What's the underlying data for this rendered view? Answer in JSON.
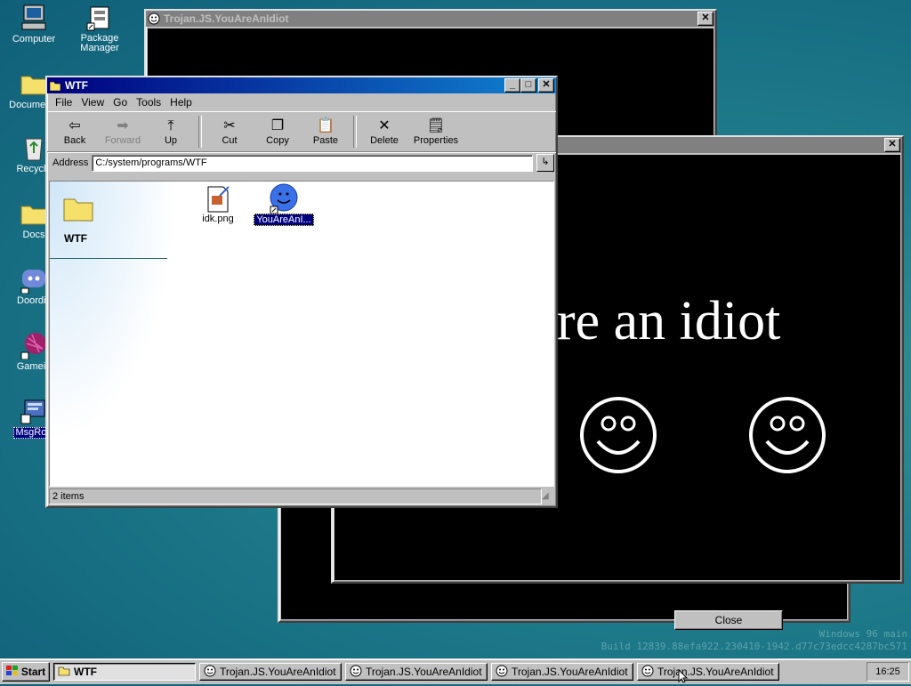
{
  "desktop": {
    "icons": [
      {
        "label": "Computer"
      },
      {
        "label": "Package Manager"
      },
      {
        "label": "Documents"
      },
      {
        "label": "Recycle"
      },
      {
        "label": "Docs"
      },
      {
        "label": "Doordis"
      },
      {
        "label": "Gamein"
      },
      {
        "label": "MsgRoo"
      }
    ]
  },
  "idiot_windows": {
    "title": "Trojan.JS.YouAreAnIdiot",
    "message": "re an idiot",
    "close_label": "Close"
  },
  "explorer": {
    "title": "WTF",
    "menu": [
      "File",
      "View",
      "Go",
      "Tools",
      "Help"
    ],
    "toolbar": {
      "back": "Back",
      "forward": "Forward",
      "up": "Up",
      "cut": "Cut",
      "copy": "Copy",
      "paste": "Paste",
      "delete": "Delete",
      "properties": "Properties"
    },
    "address_label": "Address",
    "address_value": "C:/system/programs/WTF",
    "folder_title": "WTF",
    "files": [
      {
        "name": "idk.png"
      },
      {
        "name": "YouAreAnI..."
      }
    ],
    "status": "2 items"
  },
  "taskbar": {
    "start": "Start",
    "tasks": [
      "WTF",
      "Trojan.JS.YouAreAnIdiot",
      "Trojan.JS.YouAreAnIdiot",
      "Trojan.JS.YouAreAnIdiot",
      "Trojan.JS.YouAreAnIdiot"
    ],
    "clock": "16:25"
  },
  "watermark": {
    "line1": "Windows 96 main",
    "line2": "Build 12839.88efa922.230410-1942.d77c73edcc4287bc571"
  }
}
